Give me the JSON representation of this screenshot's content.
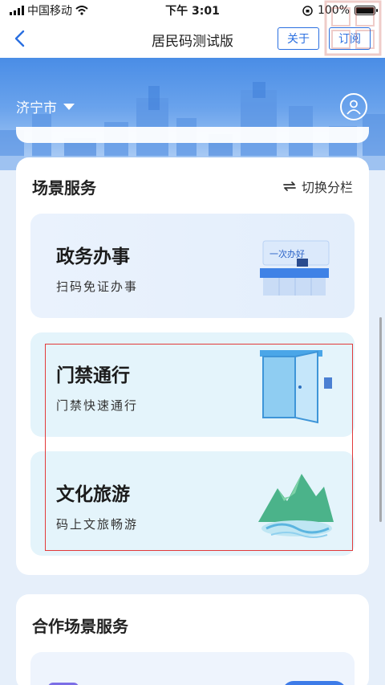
{
  "status_bar": {
    "carrier": "中国移动",
    "time": "下午 3:01",
    "battery": "100%"
  },
  "nav": {
    "title": "居民码测试版",
    "about_label": "关于",
    "subscribe_label": "订阅"
  },
  "hero": {
    "city": "济宁市"
  },
  "scene_services": {
    "title": "场景服务",
    "switch_label": "切换分栏",
    "items": [
      {
        "title": "政务办事",
        "subtitle": "扫码免证办事",
        "art_text": "一次办好"
      },
      {
        "title": "门禁通行",
        "subtitle": "门禁快速通行"
      },
      {
        "title": "文化旅游",
        "subtitle": "码上文旅畅游"
      }
    ]
  },
  "coop_services": {
    "title": "合作场景服务"
  },
  "colors": {
    "accent": "#2a6fe0",
    "highlight_border": "#e23a3a"
  }
}
